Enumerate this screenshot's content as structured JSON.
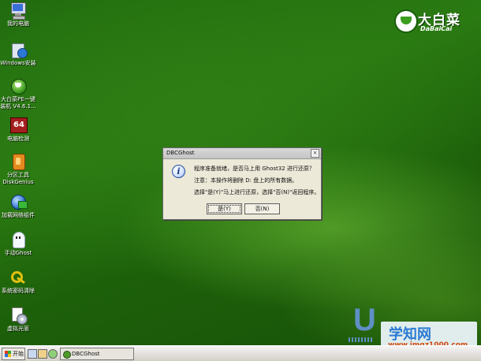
{
  "desktop": {
    "icons": [
      {
        "label": "我的电脑",
        "icon": "my-computer-icon"
      },
      {
        "label": "Windows安装",
        "icon": "windows-setup-icon"
      },
      {
        "label1": "大白菜PE一键",
        "label2": "装机 V4.6.1...",
        "icon": "dabaicai-pe-installer-icon"
      },
      {
        "label": "电脑检测",
        "icon": "aida64-icon"
      },
      {
        "label1": "分区工具",
        "label2": "DiskGenius",
        "icon": "diskgenius-icon"
      },
      {
        "label": "加载网络组件",
        "icon": "network-component-icon"
      },
      {
        "label": "手动Ghost",
        "icon": "ghost-icon"
      },
      {
        "label": "系统密码清除",
        "icon": "key-icon"
      },
      {
        "label": "虚拟光驱",
        "icon": "virtual-cd-icon"
      }
    ]
  },
  "brand": {
    "name": "大白菜",
    "sub": "DaBaiCai"
  },
  "dialog": {
    "title": "DBCGhost",
    "close": "×",
    "line1": "程序准备就绪，是否马上用 Ghost32 进行还原？",
    "line2": "注意：本操作将删除 D: 盘上的所有数据。",
    "line3": "选择\"是(Y)\"马上进行还原，选择\"否(N)\"返回程序。",
    "yes": "是(Y)",
    "no": "否(N)"
  },
  "watermark": {
    "main": "学知网",
    "url": "www.jmqz1000.com"
  },
  "taskbar": {
    "start": "开始",
    "task": "DBCGhost"
  }
}
